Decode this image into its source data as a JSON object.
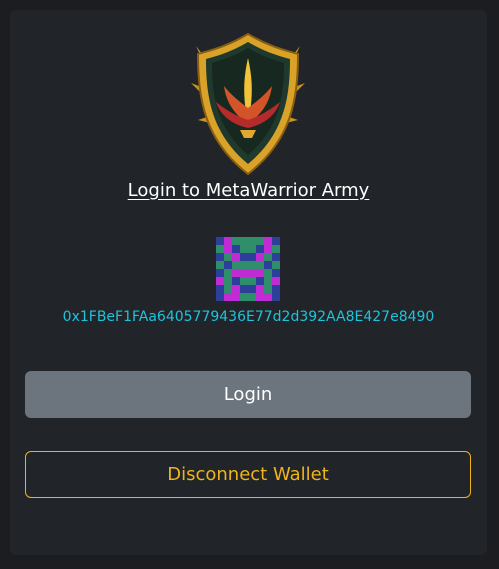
{
  "title": "Login to MetaWarrior Army",
  "wallet_address": "0x1FBeF1FAa6405779436E77d2d392AA8E427e8490",
  "login_label": "Login",
  "disconnect_label": "Disconnect Wallet",
  "colors": {
    "background": "#1b1d21",
    "card": "#212429",
    "address": "#1ec3dc",
    "login_button": "#6c757d",
    "disconnect_accent": "#f0b31b"
  },
  "icons": {
    "logo": "shield-crest-icon",
    "avatar": "identicon-avatar"
  }
}
